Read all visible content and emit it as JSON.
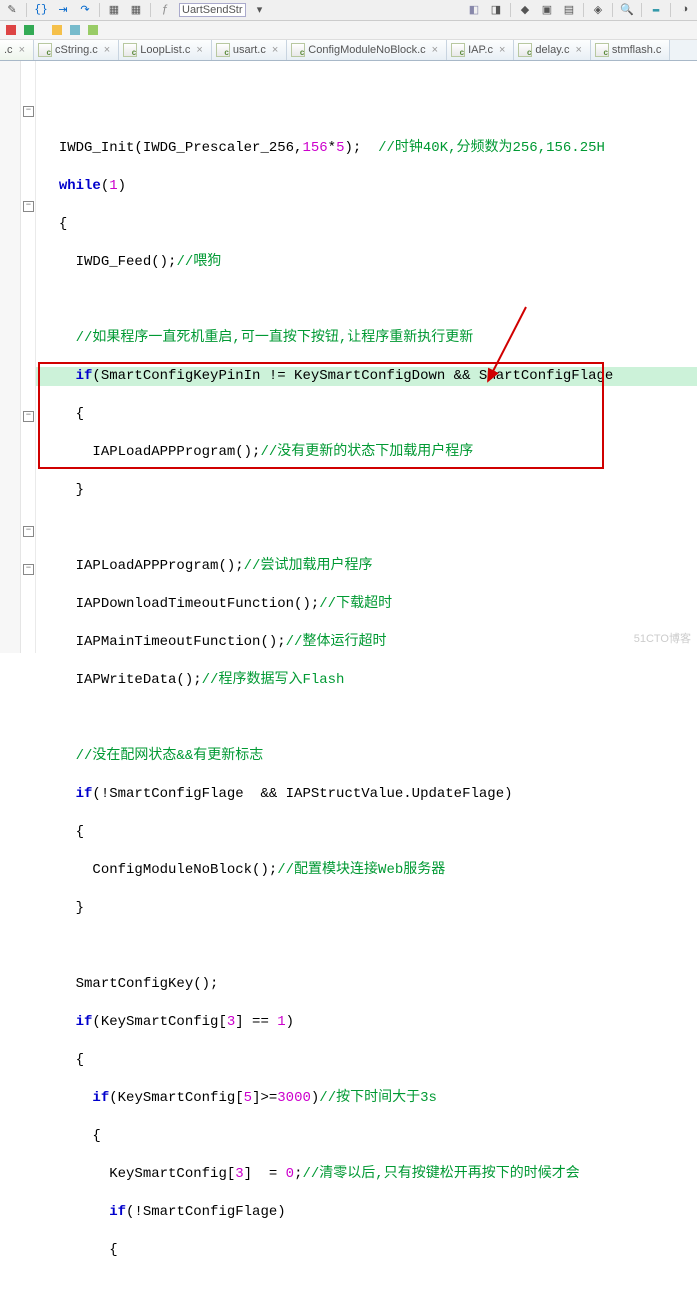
{
  "toolbar": {
    "label_uartsend": "UartSendStr"
  },
  "tabs": [
    {
      "label": ".c"
    },
    {
      "label": "cString.c"
    },
    {
      "label": "LoopList.c"
    },
    {
      "label": "usart.c"
    },
    {
      "label": "ConfigModuleNoBlock.c"
    },
    {
      "label": "IAP.c"
    },
    {
      "label": "delay.c"
    },
    {
      "label": "stmflash.c"
    }
  ],
  "code": {
    "l1a": "IWDG_Init(IWDG_Prescaler_256,",
    "l1b": "156",
    "l1c": "*",
    "l1d": "5",
    "l1e": ");  ",
    "l1f": "//时钟40K,分频数为256,156.25H",
    "l2a": "while",
    "l2b": "(",
    "l2c": "1",
    "l2d": ")",
    "l3": "{",
    "l4a": "  IWDG_Feed();",
    "l4b": "//喂狗",
    "l5": "",
    "l6": "  //如果程序一直死机重启,可一直按下按钮,让程序重新执行更新",
    "l7a": "  if",
    "l7b": "(SmartConfigKeyPinIn != KeySmartConfigDown && SmartConfigFlage",
    "l8": "  {",
    "l9a": "    IAPLoadAPPProgram();",
    "l9b": "//没有更新的状态下加载用户程序",
    "l10": "  }",
    "l11": "",
    "l12a": "  IAPLoadAPPProgram();",
    "l12b": "//尝试加载用户程序",
    "l13a": "  IAPDownloadTimeoutFunction();",
    "l13b": "//下载超时",
    "l14a": "  IAPMainTimeoutFunction();",
    "l14b": "//整体运行超时",
    "l15a": "  IAPWriteData();",
    "l15b": "//程序数据写入Flash",
    "l16": "",
    "l17": "  //没在配网状态&&有更新标志",
    "l18a": "  if",
    "l18b": "(!SmartConfigFlage  && IAPStructValue.UpdateFlage)",
    "l19": "  {",
    "l20a": "    ConfigModuleNoBlock();",
    "l20b": "//配置模块连接Web服务器",
    "l21": "  }",
    "l22": "",
    "l23": "  SmartConfigKey();",
    "l24a": "  if",
    "l24b": "(KeySmartConfig[",
    "l24c": "3",
    "l24d": "] == ",
    "l24e": "1",
    "l24f": ")",
    "l25": "  {",
    "l26a": "    if",
    "l26b": "(KeySmartConfig[",
    "l26c": "5",
    "l26d": "]>=",
    "l26e": "3000",
    "l26f": ")",
    "l26g": "//按下时间大于3s",
    "l27": "    {",
    "l28a": "      KeySmartConfig[",
    "l28b": "3",
    "l28c": "]  = ",
    "l28d": "0",
    "l28e": ";",
    "l28f": "//清零以后,只有按键松开再按下的时候才会",
    "l29a": "      if",
    "l29b": "(!SmartConfigFlage)",
    "l30": "      {"
  },
  "watermark": "51CTO博客"
}
